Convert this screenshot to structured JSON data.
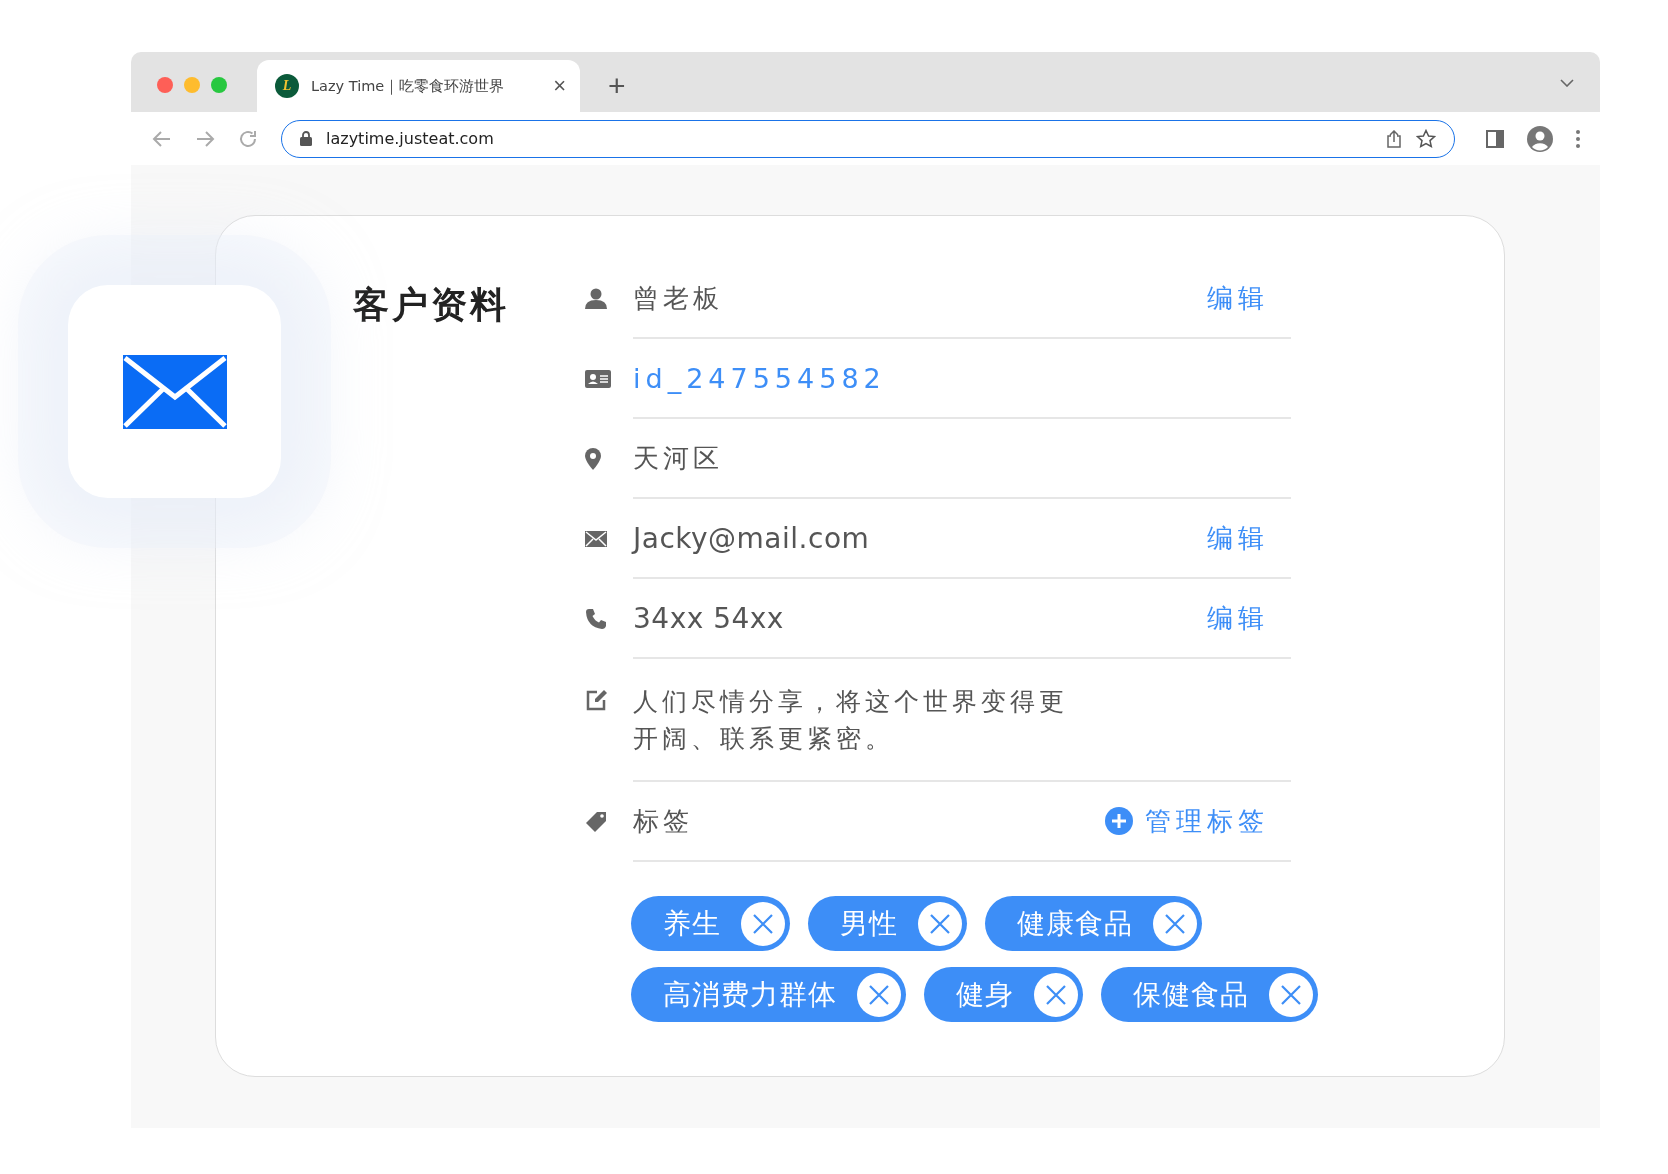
{
  "browser": {
    "tab": {
      "favicon_letter": "L",
      "title": "Lazy Time｜吃零食环游世界",
      "close": "×"
    },
    "new_tab": "+",
    "address": "lazytime.justeat.com"
  },
  "card": {
    "title": "客户资料",
    "rows": [
      {
        "kind": "name",
        "value": "曾老板",
        "action": "编辑"
      },
      {
        "kind": "id",
        "value": "id_247554582"
      },
      {
        "kind": "location",
        "value": "天河区"
      },
      {
        "kind": "email",
        "value": "Jacky@mail.com",
        "action": "编辑"
      },
      {
        "kind": "phone",
        "value": "34xx 54xx",
        "action": "编辑"
      },
      {
        "kind": "note",
        "lines": [
          "人们尽情分享，将这个世界变得更",
          "开阔、联系更紧密。"
        ]
      },
      {
        "kind": "tags",
        "value": "标签",
        "action": "管理标签"
      }
    ],
    "tags": [
      "养生",
      "男性",
      "健康食品",
      "高消费力群体",
      "健身",
      "保健食品"
    ]
  }
}
